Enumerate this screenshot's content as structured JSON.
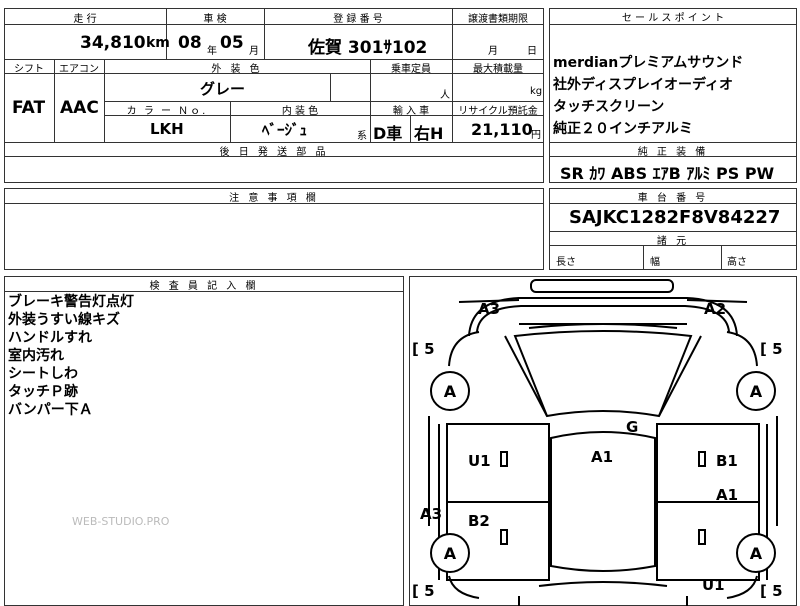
{
  "top": {
    "mileage_label": "走 行",
    "mileage_value": "34,810",
    "mileage_unit": "km",
    "shaken_label": "車 検",
    "shaken_year": "08",
    "shaken_year_unit": "年",
    "shaken_month": "05",
    "shaken_month_unit": "月",
    "reg_label": "登 録 番 号",
    "reg_value": "佐賀 301ｻ102",
    "transfer_label": "譲渡書類期限",
    "transfer_month_unit": "月",
    "transfer_day_unit": "日",
    "shift_label": "シフト",
    "shift_value": "FAT",
    "ac_label": "エアコン",
    "ac_value": "AAC",
    "exterior_label": "外 装 色",
    "exterior_value": "グレー",
    "capacity_label": "乗車定員",
    "capacity_unit": "人",
    "maxload_label": "最大積載量",
    "maxload_unit": "kg",
    "color_no_label": "カ ラ ー Ｎｏ.",
    "color_no_value": "LKH",
    "interior_label": "内 装 色",
    "interior_value": "ﾍﾞｰｼﾞｭ",
    "interior_unit": "系",
    "import_label": "輸 入 車",
    "import_value_1": "D車",
    "import_value_2": "右H",
    "recycle_label": "リサイクル預託金",
    "recycle_value": "21,110",
    "recycle_unit": "円",
    "later_parts_label": "後 日 発 送 部 品"
  },
  "sales": {
    "header": "セ ー ル ス ポ イ ン ト",
    "points": [
      "merdianプレミアムサウンド",
      "社外ディスプレイオーディオ",
      "タッチスクリーン",
      "純正２０インチアルミ"
    ],
    "equipment_header": "純 正 装 備",
    "equipment": "SR ｶﾜ ABS ｴｱB ｱﾙﾐ PS PW"
  },
  "caution": {
    "header": "注 意 事 項 欄"
  },
  "chassis": {
    "header": "車 台 番 号",
    "value": "SAJKC1282F8V84227",
    "dims_header": "諸 元",
    "length_label": "長さ",
    "width_label": "幅",
    "height_label": "高さ"
  },
  "inspector": {
    "header": "検 査 員 記 入 欄",
    "notes": [
      "ブレーキ警告灯点灯",
      "外装うすい線キズ",
      "ハンドルすれ",
      "室内汚れ",
      "シートしわ",
      "タッチＰ跡",
      "バンパー下Ａ"
    ],
    "watermark": "WEB-STUDIO.PRO"
  },
  "diagram": {
    "tire_mark": "A",
    "tread_left_top": "[ 5",
    "tread_right_top": "[ 5",
    "tread_left_bottom": "[ 5",
    "tread_right_bottom": "[ 5",
    "marks": {
      "a3_top": "A3",
      "a2_top": "A2",
      "g": "G",
      "u1_left": "U1",
      "a1_center": "A1",
      "b1_right": "B1",
      "a1_right": "A1",
      "a3_left": "A3",
      "b2_left": "B2",
      "u1_bottom": "U1"
    }
  }
}
